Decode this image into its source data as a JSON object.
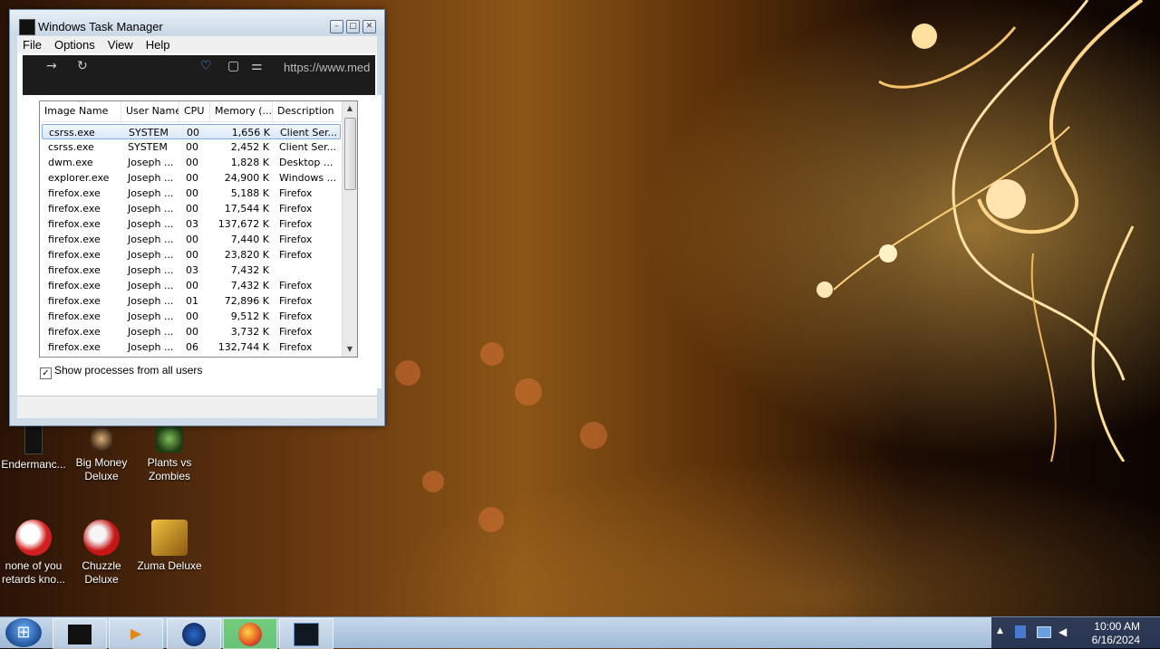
{
  "window": {
    "title": "Windows Task Manager",
    "menu": [
      "File",
      "Options",
      "View",
      "Help"
    ]
  },
  "browser_strip": {
    "url_text": "https://www.med"
  },
  "columns": [
    "Image Name",
    "User Name",
    "CPU",
    "Memory (...",
    "Description"
  ],
  "processes": [
    {
      "image": "csrss.exe",
      "user": "SYSTEM",
      "cpu": "00",
      "memory": "1,656 K",
      "desc": "Client Ser..."
    },
    {
      "image": "csrss.exe",
      "user": "SYSTEM",
      "cpu": "00",
      "memory": "2,452 K",
      "desc": "Client Ser..."
    },
    {
      "image": "dwm.exe",
      "user": "Joseph ...",
      "cpu": "00",
      "memory": "1,828 K",
      "desc": "Desktop ..."
    },
    {
      "image": "explorer.exe",
      "user": "Joseph ...",
      "cpu": "00",
      "memory": "24,900 K",
      "desc": "Windows ..."
    },
    {
      "image": "firefox.exe",
      "user": "Joseph ...",
      "cpu": "00",
      "memory": "5,188 K",
      "desc": "Firefox"
    },
    {
      "image": "firefox.exe",
      "user": "Joseph ...",
      "cpu": "00",
      "memory": "17,544 K",
      "desc": "Firefox"
    },
    {
      "image": "firefox.exe",
      "user": "Joseph ...",
      "cpu": "03",
      "memory": "137,672 K",
      "desc": "Firefox"
    },
    {
      "image": "firefox.exe",
      "user": "Joseph ...",
      "cpu": "00",
      "memory": "7,440 K",
      "desc": "Firefox"
    },
    {
      "image": "firefox.exe",
      "user": "Joseph ...",
      "cpu": "00",
      "memory": "23,820 K",
      "desc": "Firefox"
    },
    {
      "image": "firefox.exe",
      "user": "Joseph ...",
      "cpu": "03",
      "memory": "7,432 K",
      "desc": ""
    },
    {
      "image": "firefox.exe",
      "user": "Joseph ...",
      "cpu": "00",
      "memory": "7,432 K",
      "desc": "Firefox"
    },
    {
      "image": "firefox.exe",
      "user": "Joseph ...",
      "cpu": "01",
      "memory": "72,896 K",
      "desc": "Firefox"
    },
    {
      "image": "firefox.exe",
      "user": "Joseph ...",
      "cpu": "00",
      "memory": "9,512 K",
      "desc": "Firefox"
    },
    {
      "image": "firefox.exe",
      "user": "Joseph ...",
      "cpu": "00",
      "memory": "3,732 K",
      "desc": "Firefox"
    },
    {
      "image": "firefox.exe",
      "user": "Joseph ...",
      "cpu": "06",
      "memory": "132,744 K",
      "desc": "Firefox"
    }
  ],
  "show_all_users": {
    "label": "Show processes from all users",
    "checked": true
  },
  "desktop_icons": [
    {
      "label": "Endermanc..."
    },
    {
      "label": "Big Money Deluxe"
    },
    {
      "label": "Plants vs Zombies"
    },
    {
      "label": "none of you retards kno..."
    },
    {
      "label": "Chuzzle Deluxe"
    },
    {
      "label": "Zuma Deluxe"
    }
  ],
  "taskbar": {
    "clock_time": "10:00 AM",
    "clock_date": "6/16/2024"
  }
}
